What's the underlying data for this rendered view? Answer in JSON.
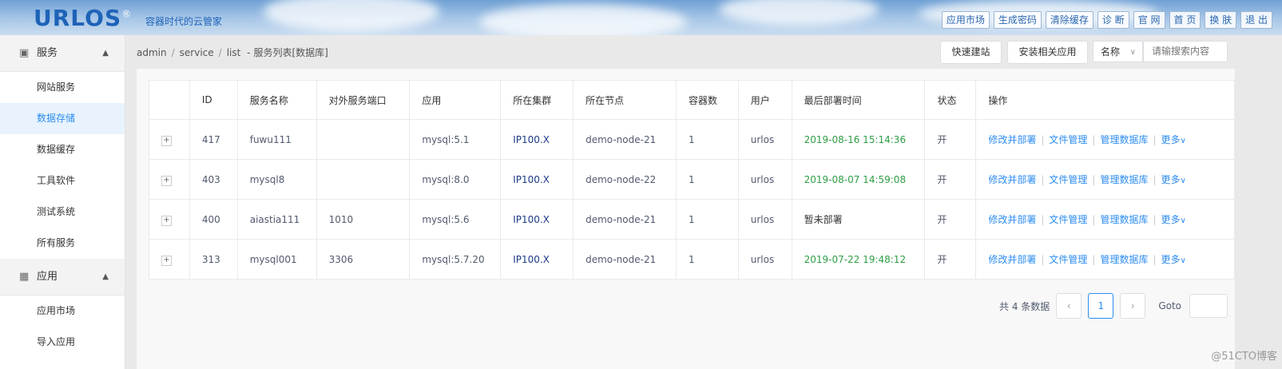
{
  "header": {
    "logo": "URLOS",
    "logo_mark": "®",
    "slogan": "容器时代的云管家",
    "buttons": [
      "应用市场",
      "生成密码",
      "清除缓存",
      "诊 断",
      "官 网",
      "首 页",
      "换 肤",
      "退 出"
    ]
  },
  "sidebar": {
    "groups": [
      {
        "label": "服务",
        "items": [
          "网站服务",
          "数据存储",
          "数据缓存",
          "工具软件",
          "测试系统",
          "所有服务"
        ]
      },
      {
        "label": "应用",
        "items": [
          "应用市场",
          "导入应用"
        ]
      }
    ],
    "active_item": "数据存储"
  },
  "breadcrumb": {
    "parts": [
      "admin",
      "service",
      "list"
    ],
    "title": "服务列表[数据库]"
  },
  "toolbar": {
    "quick_build": "快速建站",
    "install_app": "安装相关应用",
    "select_value": "名称",
    "search_placeholder": "请输搜索内容"
  },
  "table": {
    "headers": [
      "ID",
      "服务名称",
      "对外服务端口",
      "应用",
      "所在集群",
      "所在节点",
      "容器数",
      "用户",
      "最后部署时间",
      "状态",
      "操作"
    ],
    "rows": [
      {
        "id": "417",
        "name": "fuwu111",
        "port": "",
        "app": "mysql:5.1",
        "cluster": "IP100.X",
        "node": "demo-node-21",
        "containers": "1",
        "user": "urlos",
        "deploy": "2019-08-16 15:14:36",
        "status": "开"
      },
      {
        "id": "403",
        "name": "mysql8",
        "port": "",
        "app": "mysql:8.0",
        "cluster": "IP100.X",
        "node": "demo-node-22",
        "containers": "1",
        "user": "urlos",
        "deploy": "2019-08-07 14:59:08",
        "status": "开"
      },
      {
        "id": "400",
        "name": "aiastia111",
        "port": "1010",
        "app": "mysql:5.6",
        "cluster": "IP100.X",
        "node": "demo-node-21",
        "containers": "1",
        "user": "urlos",
        "deploy": "暂未部署",
        "status": "开"
      },
      {
        "id": "313",
        "name": "mysql001",
        "port": "3306",
        "app": "mysql:5.7.20",
        "cluster": "IP100.X",
        "node": "demo-node-21",
        "containers": "1",
        "user": "urlos",
        "deploy": "2019-07-22 19:48:12",
        "status": "开"
      }
    ],
    "ops": [
      "修改并部署",
      "文件管理",
      "管理数据库",
      "更多"
    ],
    "expand_symbol": "+"
  },
  "pagination": {
    "total_text": "共 4 条数据",
    "current_page": "1",
    "goto_label": "Goto",
    "prev": "‹",
    "next": "›"
  },
  "watermark": "@51CTO博客",
  "colors": {
    "accent": "#2d8cf0",
    "deploy_time": "#2f9e44",
    "cluster": "#1b3a8a"
  }
}
